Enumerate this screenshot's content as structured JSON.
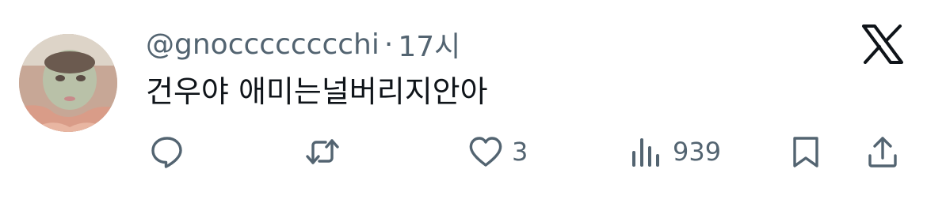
{
  "tweet": {
    "handle": "@gnocccccccchi",
    "separator": "·",
    "time": "17시",
    "text": "건우야 애미는널버리지안아"
  },
  "actions": {
    "reply_icon": "reply-icon",
    "retweet_icon": "retweet-icon",
    "like_icon": "heart-icon",
    "like_count": "3",
    "views_icon": "views-icon",
    "views_count": "939",
    "bookmark_icon": "bookmark-icon",
    "share_icon": "share-icon"
  },
  "colors": {
    "secondary_text": "#536471",
    "primary_text": "#0f1419",
    "background": "#ffffff",
    "logo": "#0f1419"
  }
}
